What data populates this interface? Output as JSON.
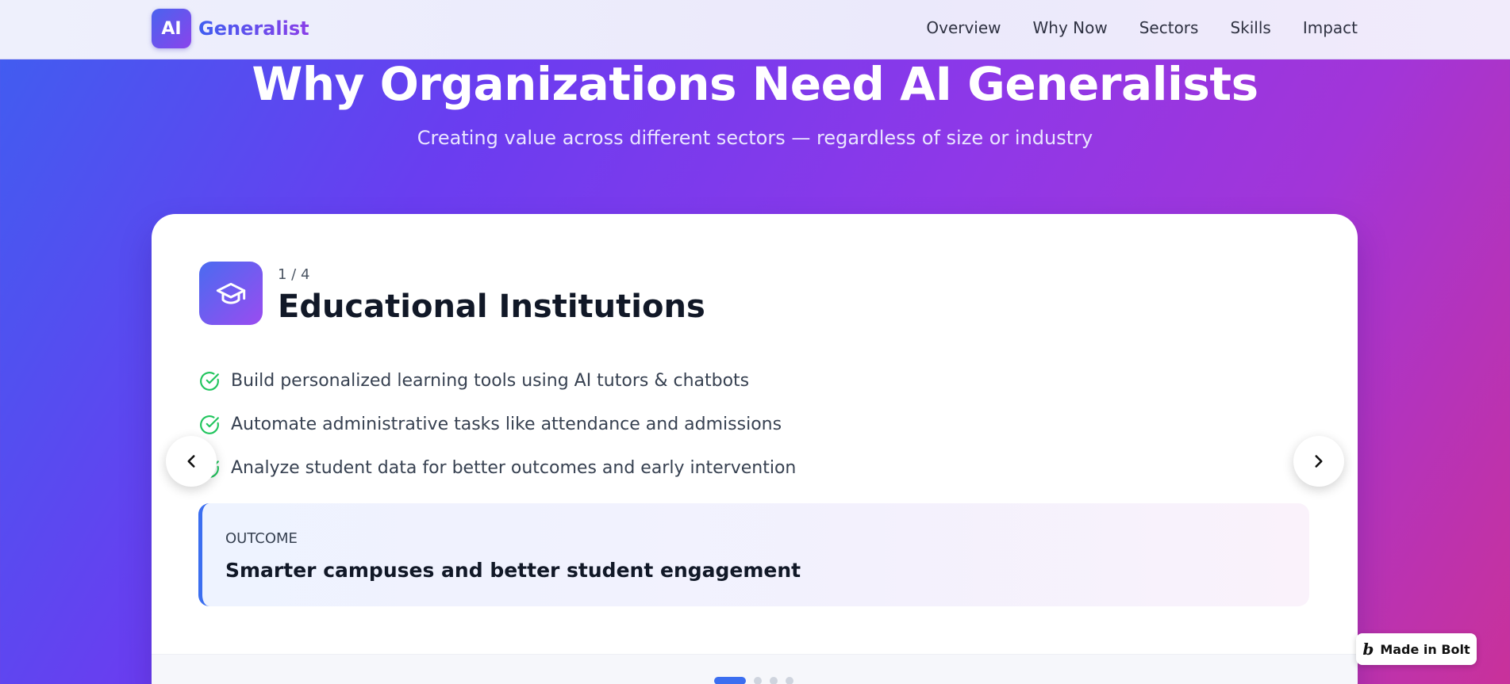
{
  "nav": {
    "logo_mark": "AI",
    "logo_text": "Generalist",
    "links": [
      "Overview",
      "Why Now",
      "Sectors",
      "Skills",
      "Impact"
    ]
  },
  "hero": {
    "title": "Why Organizations Need AI Generalists",
    "subtitle": "Creating value across different sectors — regardless of size or industry"
  },
  "sector": {
    "counter": "1 / 4",
    "icon": "graduation-cap-icon",
    "title": "Educational Institutions",
    "bullets": [
      "Build personalized learning tools using AI tutors & chatbots",
      "Automate administrative tasks like attendance and admissions",
      "Analyze student data for better outcomes and early intervention"
    ],
    "outcome_label": "OUTCOME",
    "outcome_text": "Smarter campuses and better student engagement"
  },
  "carousel": {
    "total_slides": 4,
    "active_slide": 1,
    "prev_icon": "chevron-left-icon",
    "next_icon": "chevron-right-icon"
  },
  "badge": {
    "label": "Made in Bolt",
    "mark": "b"
  },
  "colors": {
    "accent": "#3b6ef0",
    "check": "#22c55e",
    "gradient_start": "#3f5ef0",
    "gradient_end": "#c9319a"
  }
}
